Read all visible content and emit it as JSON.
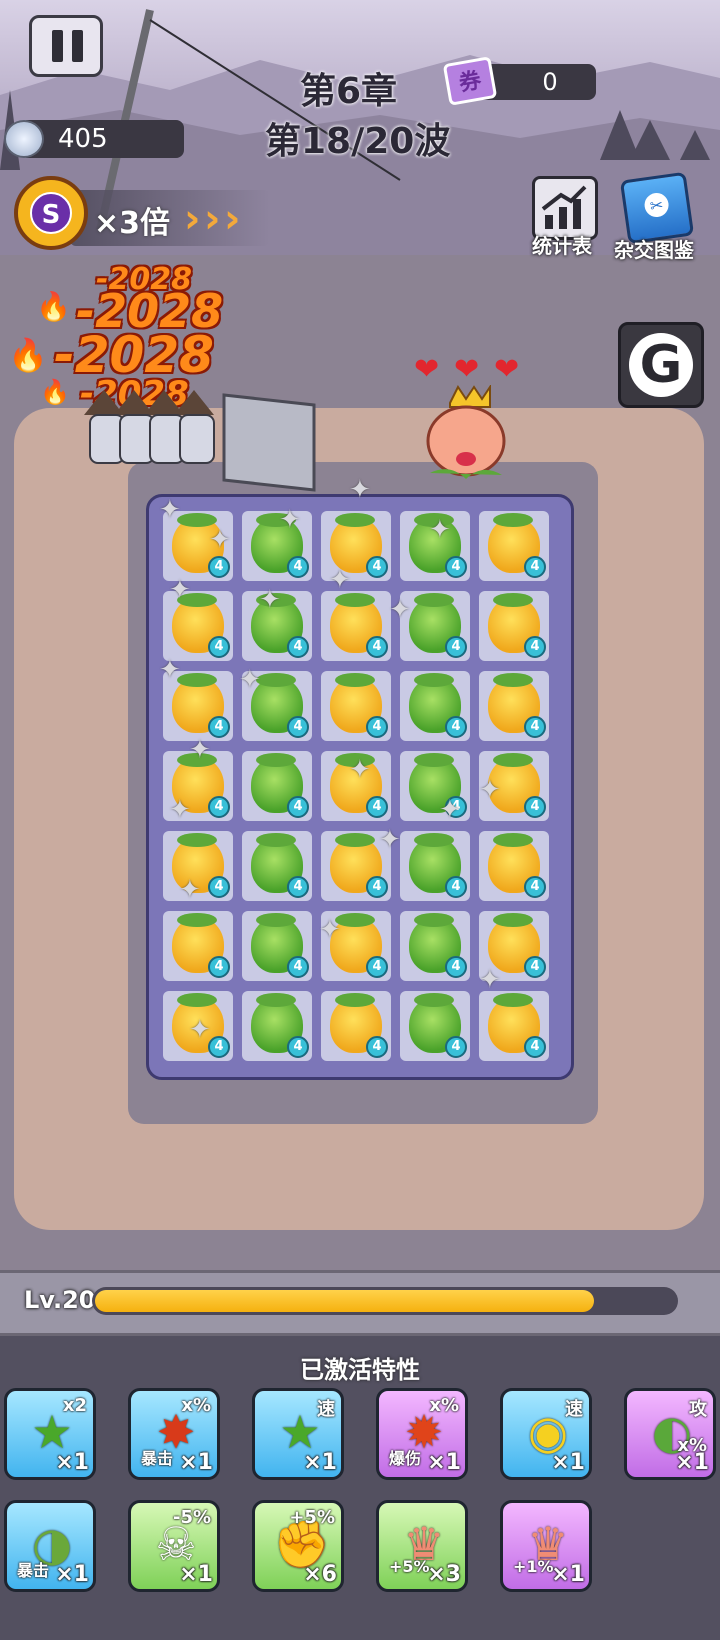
{
  "hud": {
    "pause_label": "pause",
    "chapter": "第6章",
    "wave": "第18/20波",
    "ticket_icon_text": "券",
    "ticket_count": "0",
    "gems": "405",
    "speed_badge": "S",
    "speed_multiplier": "×3倍",
    "stats_label": "统计表",
    "hybrid_label": "杂交图鉴",
    "g_label": "G"
  },
  "damage_numbers": [
    "-2028",
    "-2028",
    "-2028",
    "-2028"
  ],
  "boss": {
    "hearts": 3
  },
  "board": {
    "rows": [
      [
        "yellow",
        "green",
        "yellow",
        "green",
        "yellow"
      ],
      [
        "yellow",
        "green",
        "yellow",
        "green",
        "yellow"
      ],
      [
        "yellow",
        "green",
        "yellow",
        "green",
        "yellow"
      ],
      [
        "yellow",
        "green",
        "yellow",
        "green",
        "yellow"
      ],
      [
        "yellow",
        "green",
        "yellow",
        "green",
        "yellow"
      ],
      [
        "yellow",
        "green",
        "yellow",
        "green",
        "yellow"
      ],
      [
        "yellow",
        "green",
        "yellow",
        "green",
        "yellow"
      ]
    ],
    "level": "4"
  },
  "level_bar": {
    "label": "Lv.20",
    "progress_fraction": 0.86
  },
  "traits_panel": {
    "title": "已激活特性",
    "traits": [
      {
        "icon": "star-fruit-icon",
        "style": "blue",
        "mod": "x2",
        "count": "×1"
      },
      {
        "icon": "crit-icon",
        "style": "blue",
        "mod": "x%",
        "count": "×1",
        "tag": "暴击"
      },
      {
        "icon": "star-fruit-icon",
        "style": "blue",
        "mod": "速",
        "count": "×1"
      },
      {
        "icon": "explode-icon",
        "style": "purple",
        "mod": "x%",
        "count": "×1",
        "tag": "爆伤"
      },
      {
        "icon": "lemon-icon",
        "style": "blue",
        "mod": "速",
        "count": "×1"
      },
      {
        "icon": "melon-slice-icon",
        "style": "purple",
        "mod": "攻",
        "count": "×1",
        "mod2": "x%"
      },
      {
        "icon": "melon-crit-icon",
        "style": "blue",
        "mod": "",
        "count": "×1",
        "tag": "暴击"
      },
      {
        "icon": "skull-icon",
        "style": "green",
        "mod": "-5%",
        "count": "×1"
      },
      {
        "icon": "fist-icon",
        "style": "green",
        "mod": "+5%",
        "count": "×6"
      },
      {
        "icon": "peach-queen-icon",
        "style": "green",
        "mod": "",
        "count": "×3",
        "tag": "+5%"
      },
      {
        "icon": "peach-queen-icon",
        "style": "purple",
        "mod": "",
        "count": "×1",
        "tag": "+1%"
      }
    ]
  }
}
